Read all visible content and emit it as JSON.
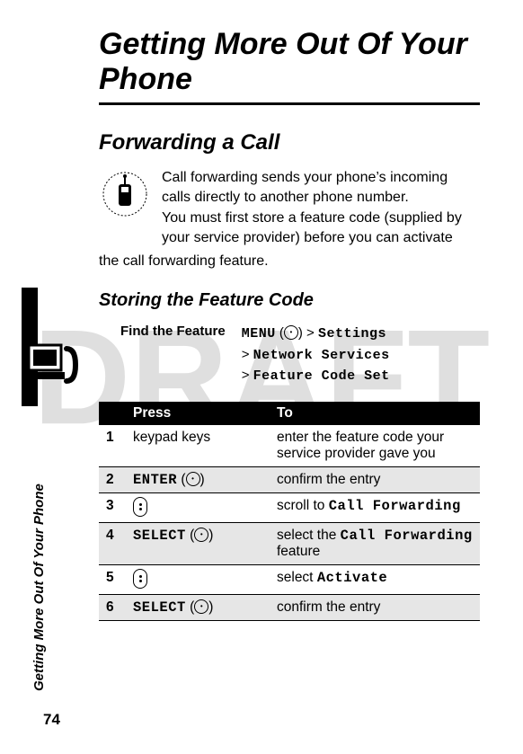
{
  "watermark": "DRAFT",
  "page_number": "74",
  "running_head": "Getting More Out Of Your Phone",
  "title": "Getting More Out Of Your Phone",
  "section": "Forwarding a Call",
  "intro_p1": "Call forwarding sends your phone’s incoming calls directly to another phone number.",
  "intro_p2": "You must first store a feature code (supplied by your service provider) before you can activate the call forwarding feature.",
  "subsection": "Storing the Feature Code",
  "find_label": "Find the Feature",
  "find_path": {
    "l1a": "MENU",
    "l1b": "(",
    "l1c": ") >",
    "l1d": "Settings",
    "l2a": ">",
    "l2b": "Network Services",
    "l3a": ">",
    "l3b": "Feature Code Set"
  },
  "table": {
    "head_press": "Press",
    "head_to": "To",
    "rows": [
      {
        "n": "1",
        "press": "keypad keys",
        "to": "enter the feature code your service provider gave you"
      },
      {
        "n": "2",
        "press_code": "ENTER",
        "press_suffix": "(",
        "press_suffix2": ")",
        "to": "confirm the entry"
      },
      {
        "n": "3",
        "press_nav": true,
        "to_pre": "scroll to ",
        "to_code": "Call Forwarding"
      },
      {
        "n": "4",
        "press_code": "SELECT",
        "press_suffix": "(",
        "press_suffix2": ")",
        "to_pre": "select the ",
        "to_code": "Call Forwarding",
        "to_post": " feature"
      },
      {
        "n": "5",
        "press_nav": true,
        "to_pre": "select ",
        "to_code": "Activate"
      },
      {
        "n": "6",
        "press_code": "SELECT",
        "press_suffix": "(",
        "press_suffix2": ")",
        "to": "confirm the entry"
      }
    ]
  },
  "icons": {
    "network_dependent": "network-subscription-dependent-feature",
    "computer_phone": "computer-phone-icon"
  }
}
